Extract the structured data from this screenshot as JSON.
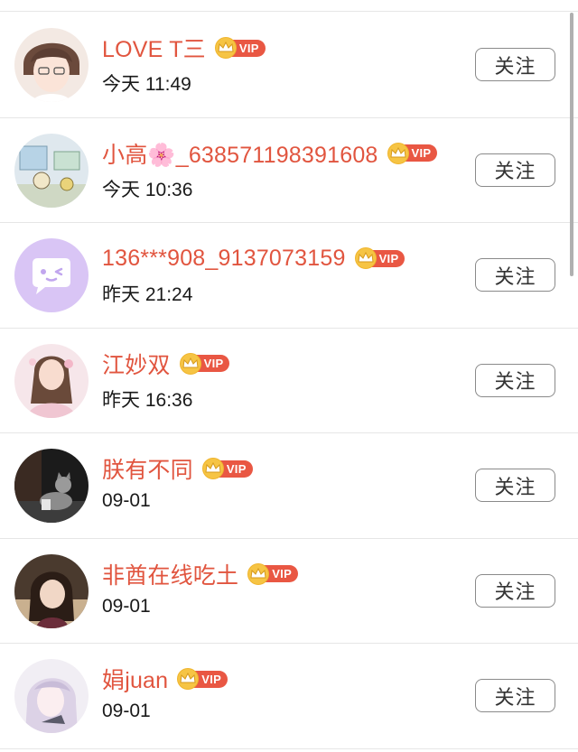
{
  "follow_label": "关注",
  "vip_label": "VIP",
  "items": [
    {
      "name": "LOVE T三",
      "time": "今天 11:49",
      "avatar": "anime-boy-avatar"
    },
    {
      "name": "小高🌸_638571198391608",
      "time": "今天 10:36",
      "avatar": "cartoon-room-avatar"
    },
    {
      "name": "136***908_9137073159",
      "time": "昨天 21:24",
      "avatar": "default-chat-avatar"
    },
    {
      "name": "江妙双",
      "time": "昨天 16:36",
      "avatar": "girl-photo-avatar"
    },
    {
      "name": "朕有不同",
      "time": "09-01",
      "avatar": "cat-photo-avatar"
    },
    {
      "name": "非酋在线吃土",
      "time": "09-01",
      "avatar": "doll-photo-avatar"
    },
    {
      "name": "娟juan",
      "time": "09-01",
      "avatar": "anime-girl-avatar"
    }
  ],
  "colors": {
    "name": "#e1553f",
    "vip_badge": "#e95743",
    "crown": "#f6c444",
    "divider": "#e6e6e6"
  }
}
